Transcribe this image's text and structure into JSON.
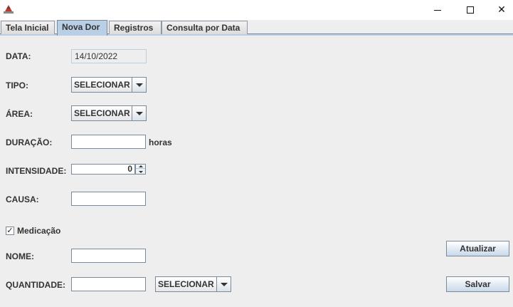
{
  "window": {
    "minimize_icon": "minimize-icon",
    "maximize_icon": "maximize-icon",
    "close_glyph": "✕"
  },
  "tabs": [
    {
      "label": "Tela Inicial",
      "active": false
    },
    {
      "label": "Nova Dor",
      "active": true
    },
    {
      "label": "Registros",
      "active": false
    },
    {
      "label": "Consulta por Data",
      "active": false
    }
  ],
  "form": {
    "data_label": "DATA:",
    "data_value": "14/10/2022",
    "tipo_label": "TIPO:",
    "tipo_value": "SELECIONAR",
    "area_label": "ÁREA:",
    "area_value": "SELECIONAR",
    "duracao_label": "DURAÇÃO:",
    "duracao_value": "",
    "duracao_unit": "horas",
    "intensidade_label": "INTENSIDADE:",
    "intensidade_value": "0",
    "causa_label": "CAUSA:",
    "causa_value": "",
    "medicacao_label": "Medicação",
    "medicacao_checked": true,
    "nome_label": "NOME:",
    "nome_value": "",
    "quantidade_label": "QUANTIDADE:",
    "quantidade_value": "",
    "quantidade_unit_value": "SELECIONAR"
  },
  "buttons": {
    "atualizar": "Atualizar",
    "salvar": "Salvar"
  },
  "colors": {
    "active_tab": "#b8cfe5",
    "background": "#eeeeee",
    "border": "#7a8a99"
  }
}
